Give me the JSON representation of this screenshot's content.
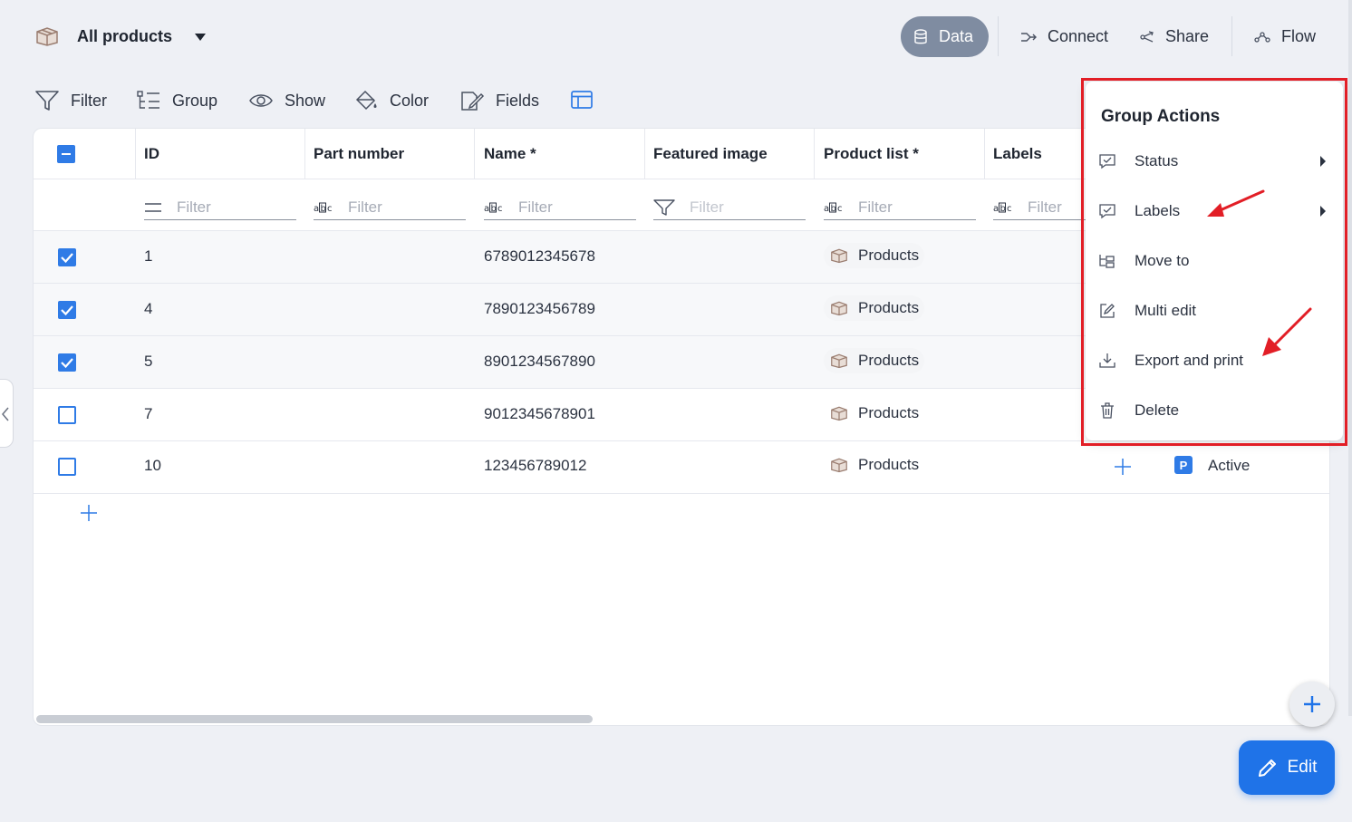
{
  "header": {
    "view_title": "All products",
    "data_label": "Data",
    "connect_label": "Connect",
    "share_label": "Share",
    "flow_label": "Flow"
  },
  "toolbar": {
    "filter_label": "Filter",
    "group_label": "Group",
    "show_label": "Show",
    "color_label": "Color",
    "fields_label": "Fields"
  },
  "table": {
    "columns": [
      "ID",
      "Part number",
      "Name *",
      "Featured image",
      "Product list *",
      "Labels"
    ],
    "filter_placeholder": "Filter",
    "rows": [
      {
        "id": "1",
        "name": "6789012345678",
        "product_list": "Products",
        "checked": true
      },
      {
        "id": "4",
        "name": "7890123456789",
        "product_list": "Products",
        "checked": true
      },
      {
        "id": "5",
        "name": "8901234567890",
        "product_list": "Products",
        "checked": true
      },
      {
        "id": "7",
        "name": "9012345678901",
        "product_list": "Products",
        "checked": false
      },
      {
        "id": "10",
        "name": "123456789012",
        "product_list": "Products",
        "checked": false,
        "status": "Active"
      }
    ]
  },
  "group_actions": {
    "title": "Group Actions",
    "items": [
      "Status",
      "Labels",
      "Move to",
      "Multi edit",
      "Export and print",
      "Delete"
    ]
  },
  "edit_label": "Edit",
  "colors": {
    "accent": "#1f73e8",
    "highlight": "#e21e26",
    "data_button": "#7f8ca1"
  }
}
